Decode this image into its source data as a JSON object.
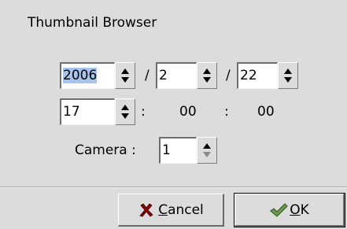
{
  "window": {
    "title": "Thumbnail Browser"
  },
  "date": {
    "year": "2006",
    "month": "2",
    "day": "22",
    "separator": "/"
  },
  "time": {
    "hour": "17",
    "colon": ":",
    "minute": "00",
    "second": "00"
  },
  "camera": {
    "label": "Camera :",
    "value": "1"
  },
  "buttons": {
    "cancel": {
      "mnemonic": "C",
      "rest": "ancel",
      "icon": "red-x-icon"
    },
    "ok": {
      "mnemonic": "O",
      "rest": "K",
      "icon": "green-checkmark-icon"
    }
  },
  "colors": {
    "background": "#dcdcdc",
    "selection": "#a6c4ec",
    "cancel_icon": "#8b0000",
    "ok_icon": "#4f7d3a"
  }
}
